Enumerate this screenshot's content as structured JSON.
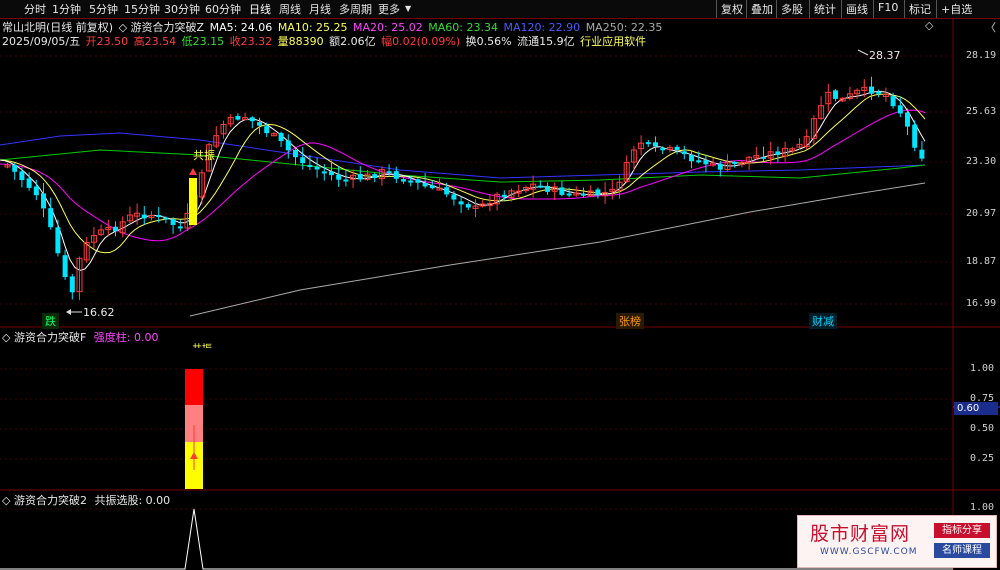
{
  "toolbar": {
    "tabs": [
      "分时",
      "1分钟",
      "5分钟",
      "15分钟",
      "30分钟",
      "60分钟",
      "日线",
      "周线",
      "月线",
      "多周期",
      "更多"
    ],
    "active": "日线",
    "right": [
      "复权",
      "叠加",
      "多股",
      "统计",
      "画线",
      "F10",
      "标记",
      "+自选"
    ]
  },
  "info": {
    "stock_name": "常山北明(日线 前复权)",
    "indicator": "◇ 游资合力突破Z",
    "ma5": "MA5: 24.06",
    "ma10": "MA10: 25.25",
    "ma20": "MA20: 25.02",
    "ma60": "MA60: 23.34",
    "ma120": "MA120: 22.90",
    "ma250": "MA250: 22.35",
    "date": "2025/09/05/五",
    "open_lbl": "开",
    "open": "23.50",
    "high_lbl": "高",
    "high": "23.54",
    "low_lbl": "低",
    "low": "23.15",
    "close_lbl": "收",
    "close": "23.32",
    "vol_lbl": "量",
    "vol": "88390",
    "amt_lbl": "额",
    "amt": "2.06亿",
    "chg_lbl": "幅",
    "chg": "0.02(0.09%)",
    "turn": "换0.56%",
    "float": "流通15.9亿",
    "industry": "行业应用软件"
  },
  "price_axis": [
    "28.19",
    "25.63",
    "23.30",
    "20.97",
    "18.87",
    "16.99"
  ],
  "annotations": {
    "high_mark": "28.37",
    "low_mark": "16.62",
    "gongzhen_top": "共振",
    "gongzhen_sub": "共振"
  },
  "events": {
    "die": "跌",
    "zhangbang": "张榜",
    "caiwu": "财减"
  },
  "pane2": {
    "title": "◇ 游资合力突破F",
    "series_name": "强度柱: 0.00",
    "axis": [
      "1.00",
      "0.75",
      "0.50",
      "0.25"
    ],
    "current": "0.60"
  },
  "pane3": {
    "title": "◇ 游资合力突破2",
    "series_name": "共振选股: 0.00",
    "axis": [
      "1.00"
    ]
  },
  "watermark": {
    "title": "股市财富网",
    "url": "WWW.GSCFW.COM",
    "tag1": "指标分享",
    "tag2": "名师课程"
  },
  "colors": {
    "up": "#ff3b3b",
    "down": "#00e5ff",
    "ma5": "#ffffff",
    "ma10": "#ffff55",
    "ma20": "#ff00ff",
    "ma60": "#00cc00",
    "ma120": "#3333ff",
    "ma250": "#aaaaaa"
  }
}
